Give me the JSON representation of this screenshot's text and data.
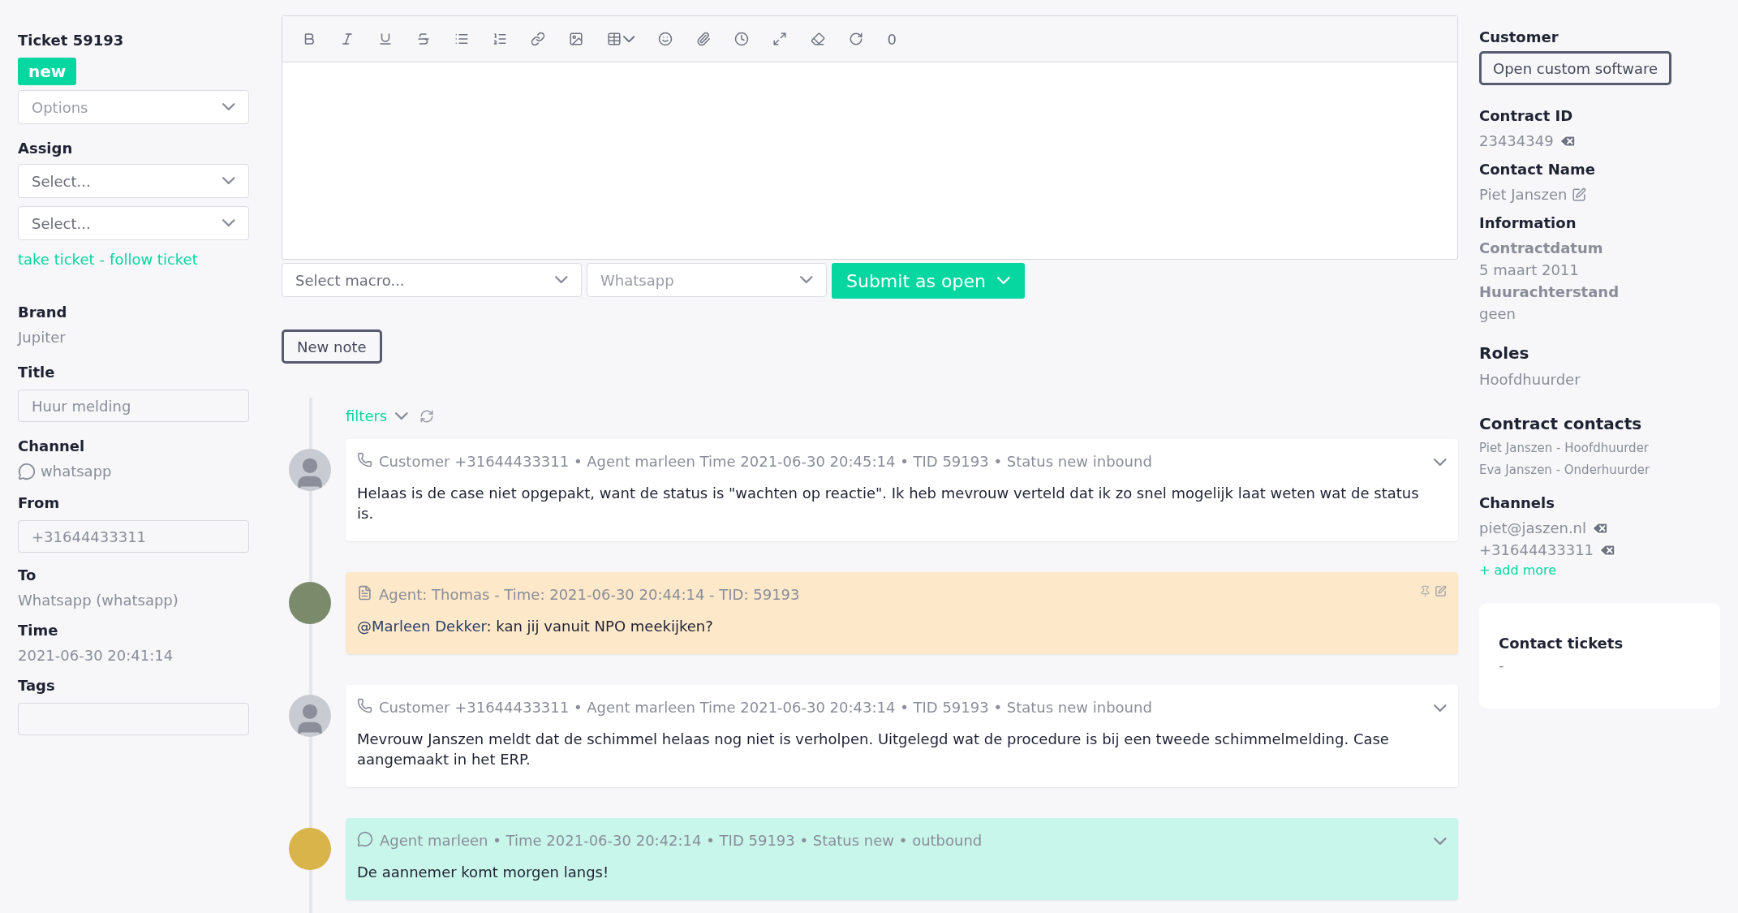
{
  "ticket": {
    "title": "Ticket 59193",
    "status": "new",
    "options": "Options",
    "assign": {
      "label": "Assign",
      "selects": [
        "Select...",
        "Select..."
      ]
    },
    "take": "take ticket",
    "separator": "-",
    "follow": "follow ticket",
    "brand": {
      "label": "Brand",
      "value": "Jupiter"
    },
    "title_field": {
      "label": "Title",
      "placeholder": "Huur melding"
    },
    "channel": {
      "label": "Channel",
      "value": "whatsapp"
    },
    "from": {
      "label": "From",
      "placeholder": "+31644433311"
    },
    "to": {
      "label": "To",
      "value": "Whatsapp (whatsapp)"
    },
    "time": {
      "label": "Time",
      "value": "2021-06-30 20:41:14"
    },
    "tags": {
      "label": "Tags"
    }
  },
  "editor": {
    "counter": "0",
    "macro": "Select macro...",
    "channel": "Whatsapp",
    "submit": "Submit as open",
    "new_note": "New note"
  },
  "timeline": {
    "filters": "filters",
    "entries": [
      {
        "kind": "customer",
        "header": "Customer +31644433311 • Agent marleen Time 2021-06-30 20:45:14 • TID 59193 • Status new inbound",
        "body": "Helaas is de case niet opgepakt, want de status is \"wachten op reactie\". Ik heb mevrouw verteld dat ik zo snel mogelijk laat weten wat de status is."
      },
      {
        "kind": "note",
        "header": "Agent: Thomas - Time: 2021-06-30 20:44:14 - TID: 59193",
        "mention": "@Marleen Dekker",
        "body": ": kan jij vanuit NPO meekijken?"
      },
      {
        "kind": "customer",
        "header": "Customer +31644433311 • Agent marleen Time 2021-06-30 20:43:14 • TID 59193 • Status new inbound",
        "body": "Mevrouw Janszen meldt dat de schimmel helaas nog niet is verholpen. Uitgelegd wat de procedure is bij een tweede schimmelmelding. Case aangemaakt in het ERP."
      },
      {
        "kind": "whatsapp",
        "header": "Agent marleen • Time 2021-06-30 20:42:14 • TID 59193 • Status new • outbound",
        "body": "De aannemer komt morgen langs!"
      }
    ]
  },
  "customer": {
    "label": "Customer",
    "button": "Open custom software",
    "contract_id": {
      "label": "Contract ID",
      "value": "23434349"
    },
    "contact_name": {
      "label": "Contact Name",
      "value": "Piet Janszen"
    },
    "information": {
      "label": "Information",
      "items": [
        {
          "term": "Contractdatum",
          "value": "5 maart 2011"
        },
        {
          "term": "Huurachterstand",
          "value": "geen"
        }
      ]
    },
    "roles": {
      "label": "Roles",
      "value": "Hoofdhuurder"
    },
    "contract_contacts": {
      "label": "Contract contacts",
      "items": [
        "Piet Janszen - Hoofdhuurder",
        "Eva Janszen - Onderhuurder"
      ]
    },
    "channels": {
      "label": "Channels",
      "items": [
        "piet@jaszen.nl",
        "+31644433311"
      ],
      "add": "+ add more"
    },
    "contact_tickets": {
      "label": "Contact tickets",
      "value": "-"
    }
  }
}
